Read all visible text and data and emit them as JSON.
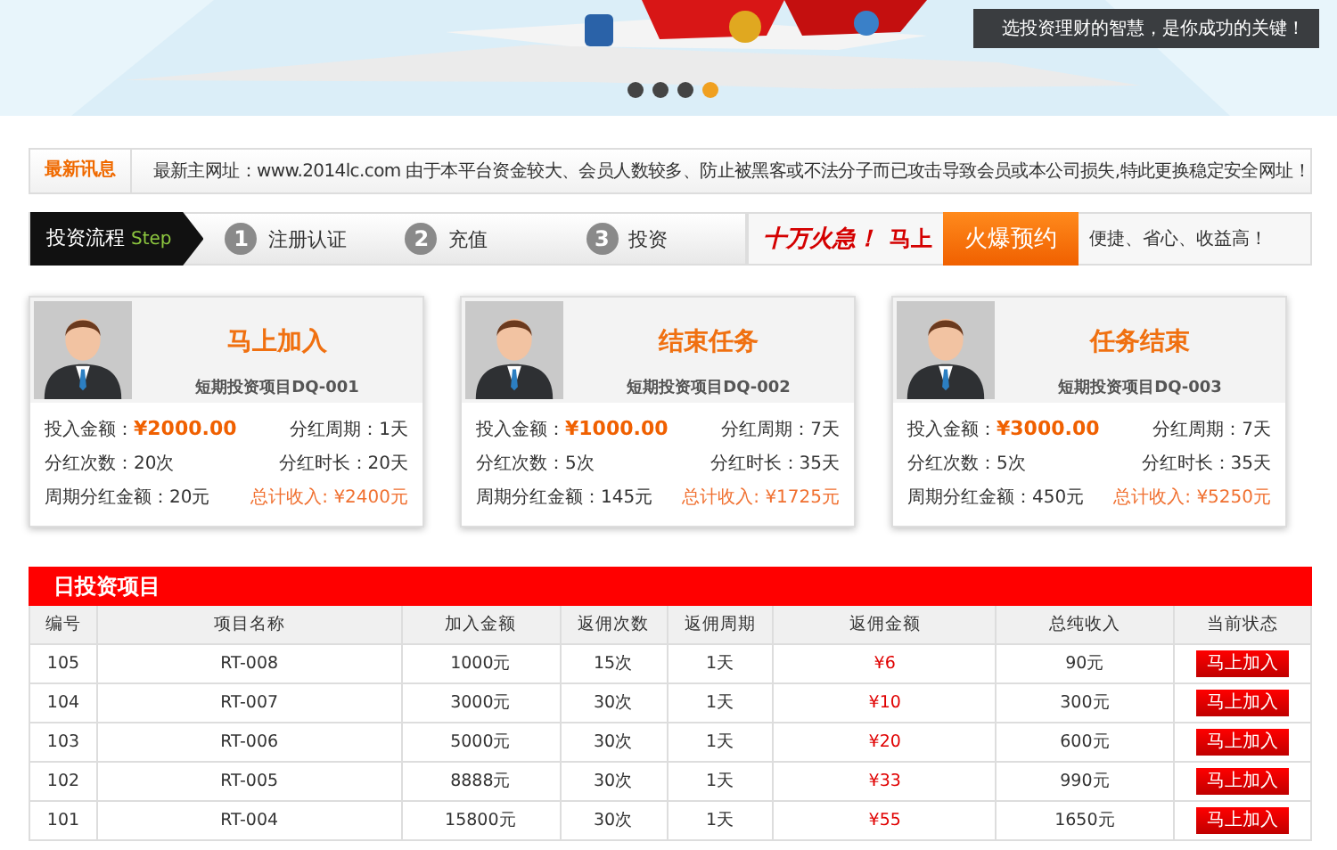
{
  "banner": {
    "caption": "选投资理财的智慧，是你成功的关键！",
    "slides": [
      {
        "selected": false
      },
      {
        "selected": false
      },
      {
        "selected": false
      },
      {
        "selected": true
      }
    ]
  },
  "news": {
    "label": "最新讯息",
    "text": "最新主网址：www.2014lc.com 由于本平台资金较大、会员人数较多、防止被黑客或不法分子而已攻击导致会员或本公司损失,特此更换稳定安全网址！"
  },
  "steps": {
    "title": "投资流程",
    "step_word": "Step",
    "items": [
      {
        "number": "1",
        "label": "注册认证"
      },
      {
        "number": "2",
        "label": "充值"
      },
      {
        "number": "3",
        "label": "投资"
      }
    ]
  },
  "promo": {
    "slogan": "十万火急！",
    "prefix": "马上",
    "button": "火爆预约",
    "tagline": "便捷、省心、收益高！"
  },
  "cards": [
    {
      "title": "马上加入",
      "subtitle": "短期投资项目DQ-001",
      "amount_label": "投入金额：",
      "amount": "¥2000.00",
      "period": "分红周期：1天",
      "count": "分红次数：20次",
      "duration": "分红时长：20天",
      "per_period": "周期分红金额：20元",
      "total": "总计收入: ¥2400元"
    },
    {
      "title": "结束任务",
      "subtitle": "短期投资项目DQ-002",
      "amount_label": "投入金额：",
      "amount": "¥1000.00",
      "period": "分红周期：7天",
      "count": "分红次数：5次",
      "duration": "分红时长：35天",
      "per_period": "周期分红金额：145元",
      "total": "总计收入: ¥1725元"
    },
    {
      "title": "任务结束",
      "subtitle": "短期投资项目DQ-003",
      "amount_label": "投入金额：",
      "amount": "¥3000.00",
      "period": "分红周期：7天",
      "count": "分红次数：5次",
      "duration": "分红时长：35天",
      "per_period": "周期分红金额：450元",
      "total": "总计收入: ¥5250元"
    }
  ],
  "table": {
    "title": "日投资项目",
    "columns": [
      "编号",
      "项目名称",
      "加入金额",
      "返佣次数",
      "返佣周期",
      "返佣金额",
      "总纯收入",
      "当前状态"
    ],
    "rows": [
      {
        "id": "105",
        "name": "RT-008",
        "amount": "1000元",
        "times": "15次",
        "period": "1天",
        "rebate": "¥6",
        "total": "90元",
        "action": "马上加入"
      },
      {
        "id": "104",
        "name": "RT-007",
        "amount": "3000元",
        "times": "30次",
        "period": "1天",
        "rebate": "¥10",
        "total": "300元",
        "action": "马上加入"
      },
      {
        "id": "103",
        "name": "RT-006",
        "amount": "5000元",
        "times": "30次",
        "period": "1天",
        "rebate": "¥20",
        "total": "600元",
        "action": "马上加入"
      },
      {
        "id": "102",
        "name": "RT-005",
        "amount": "8888元",
        "times": "30次",
        "period": "1天",
        "rebate": "¥33",
        "total": "990元",
        "action": "马上加入"
      },
      {
        "id": "101",
        "name": "RT-004",
        "amount": "15800元",
        "times": "30次",
        "period": "1天",
        "rebate": "¥55",
        "total": "1650元",
        "action": "马上加入"
      }
    ]
  }
}
